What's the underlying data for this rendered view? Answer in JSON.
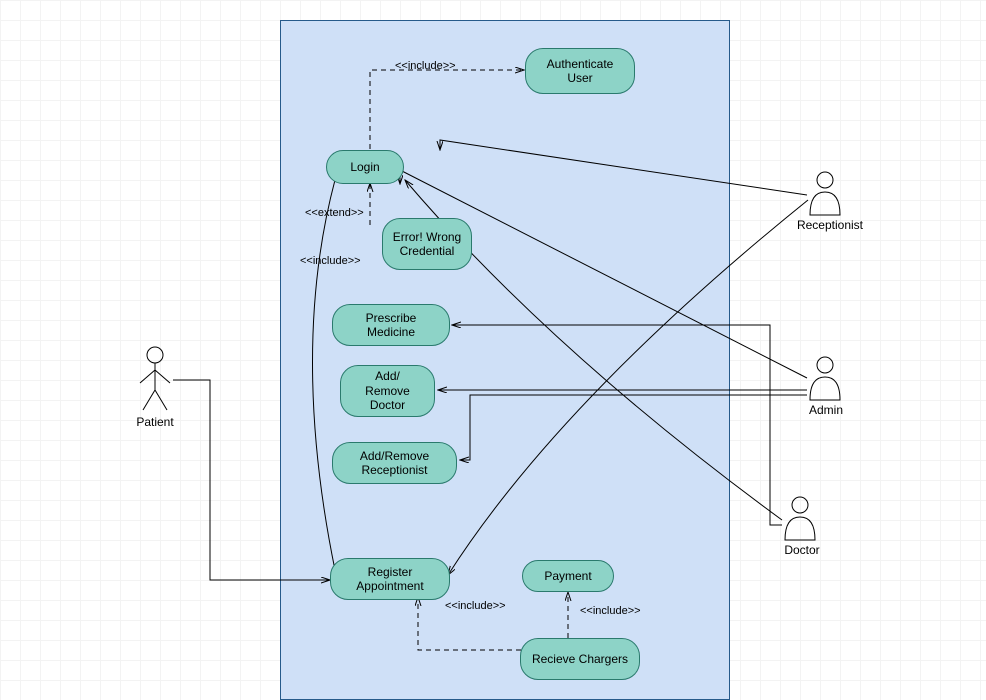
{
  "diagram_type": "UML Use Case Diagram",
  "actors": {
    "patient": {
      "label": "Patient"
    },
    "receptionist": {
      "label": "Receptionist"
    },
    "admin": {
      "label": "Admin"
    },
    "doctor": {
      "label": "Doctor"
    }
  },
  "usecases": {
    "authenticate_user": "Authenticate User",
    "login": "Login",
    "error_wrong_credential": "Error! Wrong Credential",
    "prescribe_medicine": "Prescribe Medicine",
    "add_remove_doctor": "Add/\nRemove Doctor",
    "add_remove_receptionist": "Add/Remove Receptionist",
    "register_appointment": "Register Appointment",
    "payment": "Payment",
    "recieve_chargers": "Recieve Chargers"
  },
  "stereotypes": {
    "include_auth": "<<include>>",
    "extend_error": "<<extend>>",
    "include_login_left": "<<include>>",
    "include_register": "<<include>>",
    "include_payment": "<<include>>"
  },
  "relations": [
    {
      "from": "login",
      "to": "authenticate_user",
      "type": "include"
    },
    {
      "from": "error_wrong_credential",
      "to": "login",
      "type": "extend"
    },
    {
      "from": "recieve_chargers",
      "to": "register_appointment",
      "type": "include"
    },
    {
      "from": "recieve_chargers",
      "to": "payment",
      "type": "include"
    },
    {
      "from": "patient",
      "to": "register_appointment",
      "type": "assoc"
    },
    {
      "from": "receptionist",
      "to": "login",
      "type": "assoc"
    },
    {
      "from": "receptionist",
      "to": "register_appointment",
      "type": "assoc"
    },
    {
      "from": "admin",
      "to": "login",
      "type": "assoc"
    },
    {
      "from": "admin",
      "to": "add_remove_doctor",
      "type": "assoc"
    },
    {
      "from": "admin",
      "to": "add_remove_receptionist",
      "type": "assoc"
    },
    {
      "from": "doctor",
      "to": "login",
      "type": "assoc"
    },
    {
      "from": "doctor",
      "to": "prescribe_medicine",
      "type": "assoc"
    }
  ]
}
